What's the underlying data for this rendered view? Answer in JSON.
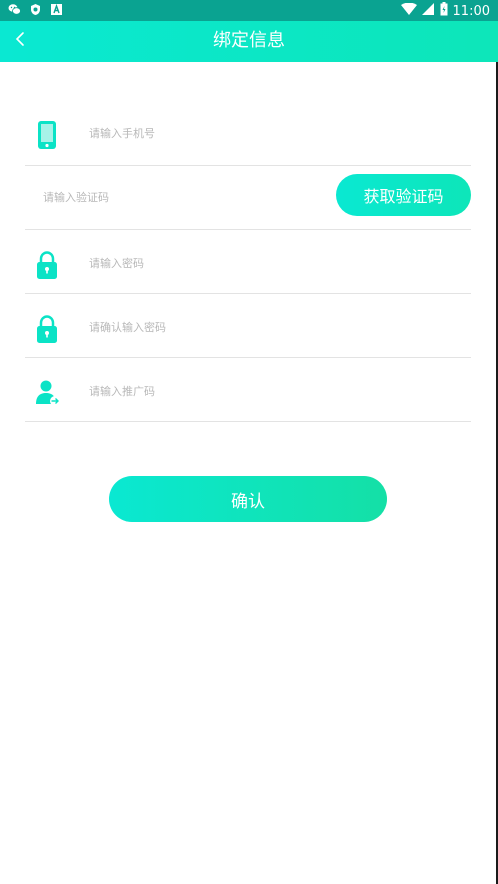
{
  "status_bar": {
    "time": "11:00",
    "left_icons": [
      "wechat-icon",
      "shield-icon",
      "a-icon"
    ],
    "right_icons": [
      "wifi-icon",
      "signal-icon",
      "battery-icon"
    ]
  },
  "header": {
    "title": "绑定信息",
    "back_icon": "chevron-left-icon"
  },
  "form": {
    "phone": {
      "placeholder": "请输入手机号",
      "value": "",
      "icon": "phone-icon"
    },
    "code": {
      "placeholder": "请输入验证码",
      "value": "",
      "button_label": "获取验证码"
    },
    "password": {
      "placeholder": "请输入密码",
      "value": "",
      "icon": "lock-icon"
    },
    "confirm_password": {
      "placeholder": "请确认输入密码",
      "value": "",
      "icon": "lock-icon"
    },
    "referral": {
      "placeholder": "请输入推广码",
      "value": "",
      "icon": "user-add-icon"
    }
  },
  "confirm_button": {
    "label": "确认"
  },
  "colors": {
    "accent_start": "#0ae8d2",
    "accent_end": "#0de6b9",
    "status_bar": "#0aa391",
    "divider": "#e3e3e3",
    "placeholder": "#b8b8b8"
  }
}
